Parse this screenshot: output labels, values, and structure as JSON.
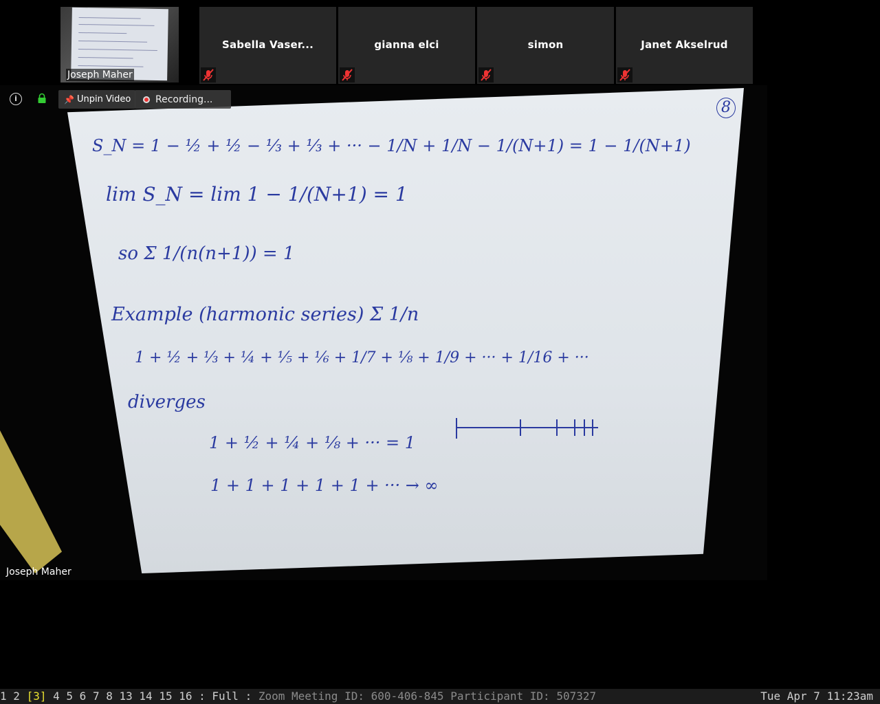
{
  "self_view": {
    "name": "Joseph Maher"
  },
  "participants": [
    {
      "name": "Sabella Vaser..."
    },
    {
      "name": "gianna elci"
    },
    {
      "name": "simon"
    },
    {
      "name": "Janet Akselrud"
    }
  ],
  "controls": {
    "unpin_label": "Unpin Video",
    "recording_label": "Recording..."
  },
  "video": {
    "speaker_name": "Joseph Maher"
  },
  "whiteboard": {
    "page_number": "8",
    "line1": "S_N = 1 − ½ + ½ − ⅓ + ⅓ + ···  − 1/N + 1/N − 1/(N+1) = 1 − 1/(N+1)",
    "line2": "lim S_N = lim 1 − 1/(N+1) = 1",
    "line3": "so Σ 1/(n(n+1)) = 1",
    "line4": "Example (harmonic series) Σ 1/n",
    "line5": "1 + ½ + ⅓ + ¼ + ⅕ + ⅙ + 1/7 + ⅛ + 1/9 + ··· + 1/16 + ···",
    "line6": "diverges",
    "line7": "1 + ½ + ¼ + ⅛ + ··· = 1",
    "line8": "1 + 1 + 1 + 1 + 1 + ··· → ∞"
  },
  "statusbar": {
    "workspaces": [
      "1",
      "2",
      "3",
      "4",
      "5",
      "6",
      "7",
      "8",
      "13",
      "14",
      "15",
      "16"
    ],
    "active_workspace": "3",
    "mode": "Full",
    "window_title": "Zoom Meeting ID: 600-406-845 Participant ID: 507327",
    "clock": "Tue Apr  7 11:23am"
  }
}
